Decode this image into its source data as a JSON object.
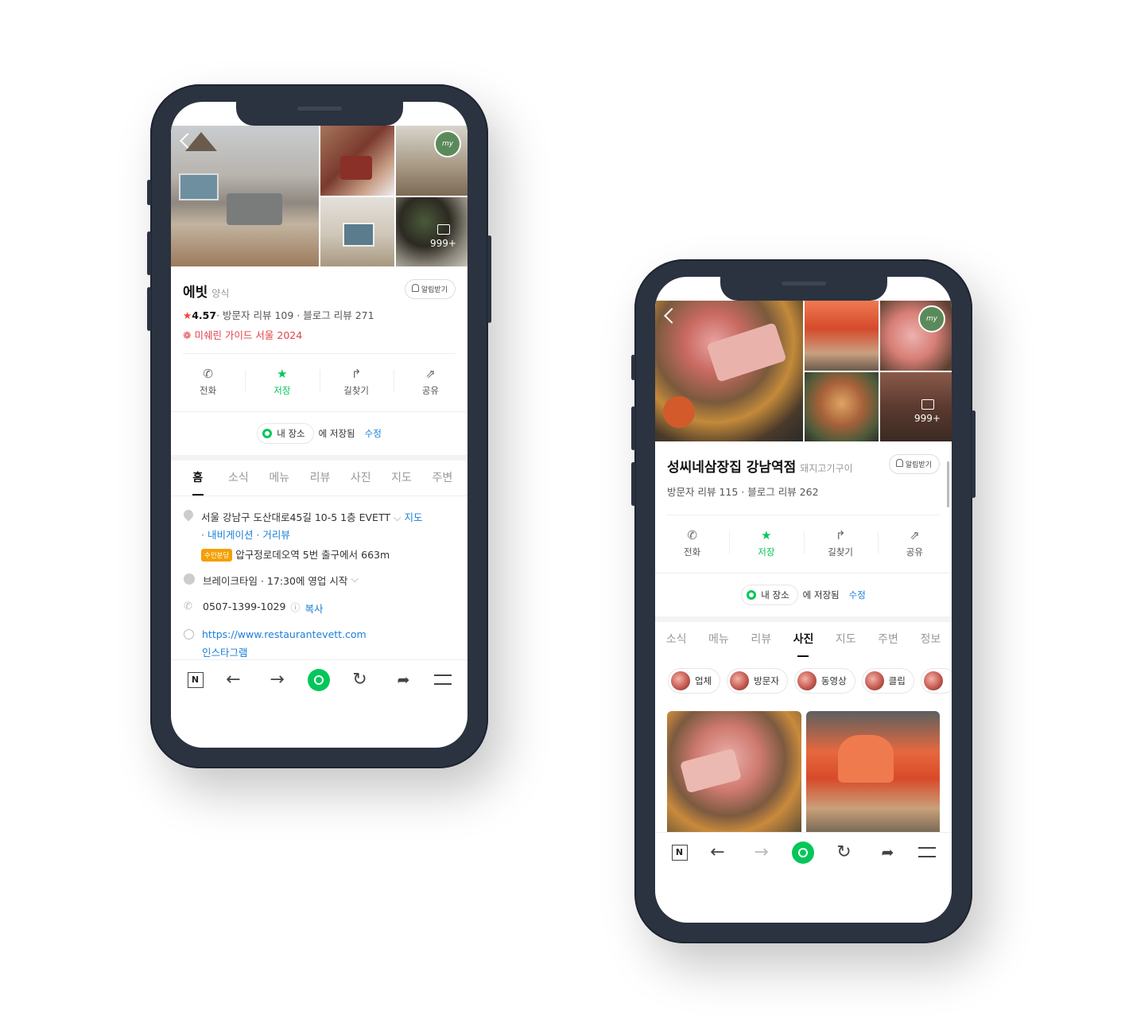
{
  "phone_left": {
    "photo_count": "999+",
    "my_badge": "my",
    "place": {
      "name": "에빗",
      "category": "양식",
      "alarm_label": "알림받기",
      "rating": "4.57",
      "visitor_reviews": "· 방문자 리뷰 109 · ",
      "blog_reviews": "블로그 리뷰 271",
      "michelin": "❁ 미쉐린 가이드 서울 2024"
    },
    "actions": [
      {
        "label": "전화",
        "icon": "phone-icon"
      },
      {
        "label": "저장",
        "icon": "star-icon"
      },
      {
        "label": "길찾기",
        "icon": "directions-icon"
      },
      {
        "label": "공유",
        "icon": "share-icon"
      }
    ],
    "saved": {
      "chip": "내 장소",
      "text": "에 저장됨",
      "edit": "수정"
    },
    "tabs": [
      "홈",
      "소식",
      "메뉴",
      "리뷰",
      "사진",
      "지도",
      "주변"
    ],
    "active_tab": "홈",
    "details": {
      "address": "서울 강남구 도산대로45길 10-5 1층 EVETT",
      "map_link": "지도",
      "nav_link": "· 내비게이션 · 거리뷰",
      "transit_badge": "수인분당",
      "transit": "압구정로데오역 5번 출구에서 663m",
      "hours": "브레이크타임 · 17:30에 영업 시작",
      "phone": "0507-1399-1029",
      "copy": "복사",
      "url": "https://www.restaurantevett.com",
      "instagram": "인스타그램"
    },
    "navbar": [
      "N"
    ]
  },
  "phone_right": {
    "photo_count": "999+",
    "my_badge": "my",
    "place": {
      "name": "성씨네삼장집 강남역점",
      "category": "돼지고기구이",
      "alarm_label": "알림받기",
      "reviews": "방문자 리뷰 115 · 블로그 리뷰 262"
    },
    "actions": [
      {
        "label": "전화",
        "icon": "phone-icon"
      },
      {
        "label": "저장",
        "icon": "star-icon"
      },
      {
        "label": "길찾기",
        "icon": "directions-icon"
      },
      {
        "label": "공유",
        "icon": "share-icon"
      }
    ],
    "saved": {
      "chip": "내 장소",
      "text": "에 저장됨",
      "edit": "수정"
    },
    "tabs": [
      "소식",
      "메뉴",
      "리뷰",
      "사진",
      "지도",
      "주변",
      "정보"
    ],
    "active_tab": "사진",
    "filters": [
      "업체",
      "방문자",
      "동영상",
      "클립"
    ],
    "navbar": [
      "N"
    ]
  },
  "colors": {
    "green": "#03c75a",
    "link": "#1a7fd8",
    "michelin": "#e4434b",
    "frame": "#2b3240"
  }
}
